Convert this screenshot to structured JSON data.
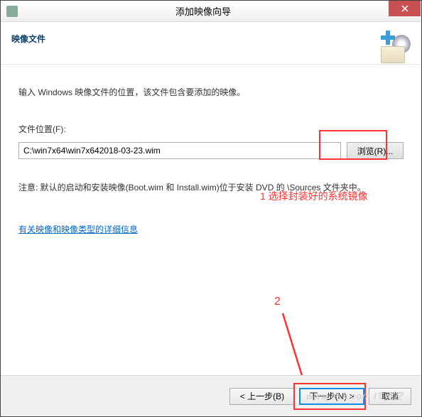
{
  "titlebar": {
    "title": "添加映像向导"
  },
  "header": {
    "title": "映像文件"
  },
  "content": {
    "instruction": "输入 Windows 映像文件的位置，该文件包含要添加的映像。",
    "file_label": "文件位置(F):",
    "file_value": "C:\\win7x64\\win7x642018-03-23.wim",
    "browse_label": "浏览(R)...",
    "note": "注意: 默认的启动和安装映像(Boot.wim 和 Install.wim)位于安装 DVD 的 \\Sources 文件夹中。",
    "link": "有关映像和映像类型的详细信息"
  },
  "annotations": {
    "step1": "1 选择封装好的系统镜像",
    "step2": "2"
  },
  "footer": {
    "back": "< 上一步(B)",
    "next": "下一步(N) >",
    "cancel": "取消"
  },
  "watermark": "www.itsk.com  IT天空"
}
